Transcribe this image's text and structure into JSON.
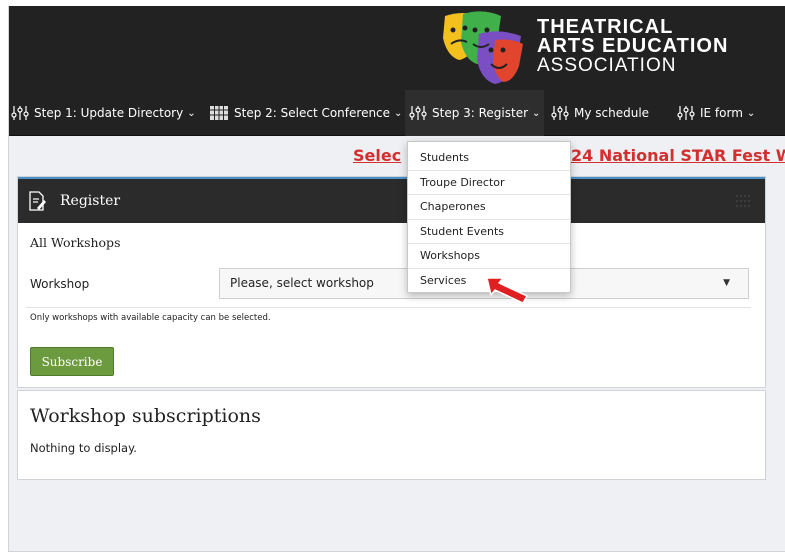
{
  "logo": {
    "line1": "THEATRICAL",
    "line2": "ARTS EDUCATION",
    "line3": "ASSOCIATION"
  },
  "nav": {
    "items": [
      {
        "label": "Step 1: Update Directory",
        "icon": "sliders-icon",
        "has_chevron": true
      },
      {
        "label": "Step 2: Select Conference",
        "icon": "calendar-grid-icon",
        "has_chevron": true
      },
      {
        "label": "Step 3: Register",
        "icon": "sliders-icon",
        "has_chevron": true
      },
      {
        "label": "My schedule",
        "icon": "sliders-icon",
        "has_chevron": false
      },
      {
        "label": "IE form",
        "icon": "sliders-icon",
        "has_chevron": true
      }
    ],
    "chevron": "⌄"
  },
  "banner": {
    "left_fragment": "Selec",
    "right_fragment": "24 National STAR Fest W"
  },
  "register_panel": {
    "title": "Register",
    "section_title": "All Workshops",
    "workshop_label": "Workshop",
    "select_value": "Please, select workshop",
    "note": "Only workshops with available capacity can be selected.",
    "subscribe_label": "Subscribe"
  },
  "subscriptions_panel": {
    "title": "Workshop subscriptions",
    "empty_text": "Nothing to display."
  },
  "dropdown": {
    "items": [
      "Students",
      "Troupe Director",
      "Chaperones",
      "Student Events",
      "Workshops",
      "Services"
    ]
  },
  "colors": {
    "header_bg": "#222222",
    "banner_text": "#d32f2f",
    "subscribe_bg": "#6b9a3f",
    "arrow": "#e02020",
    "panel_accent": "#4a90c8"
  }
}
